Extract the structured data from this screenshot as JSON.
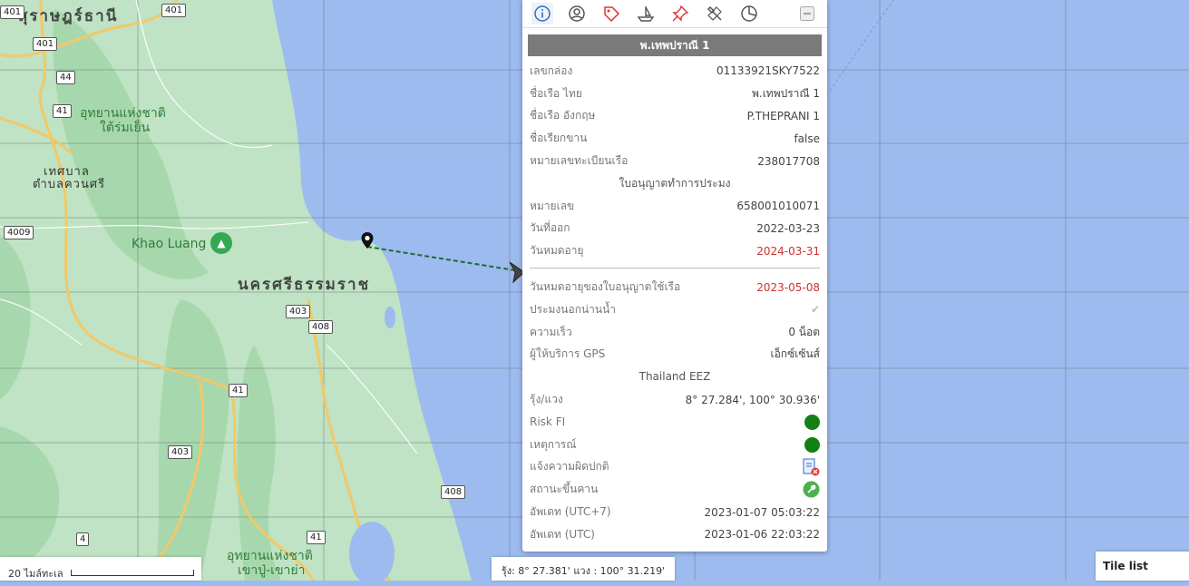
{
  "map": {
    "labels": {
      "surat_thani": "สุราษฎร์ธานี",
      "tessaban": "เทศบาล",
      "tessaban2": "ตำบลควนศรี",
      "park_north_1": "อุทยานแห่งชาติ",
      "park_north_2": "ใต้ร่มเย็น",
      "khao_luang": "Khao Luang",
      "nakhon": "นครศรีธรรมราช",
      "park_south_1": "อุทยานแห่งชาติ",
      "park_south_2": "เขาปู่-เขาย่า"
    },
    "roads": {
      "r401a": "401",
      "r401b": "401",
      "r44": "44",
      "r41a": "41",
      "r4009": "4009",
      "r403a": "403",
      "r408a": "408",
      "r41b": "41",
      "r403b": "403",
      "r408b": "408",
      "r4": "4",
      "r41c": "41"
    }
  },
  "popup": {
    "tabs": [
      {
        "name": "info"
      },
      {
        "name": "owner"
      },
      {
        "name": "tag"
      },
      {
        "name": "ship"
      },
      {
        "name": "pin"
      },
      {
        "name": "tools"
      },
      {
        "name": "chart"
      }
    ],
    "title": "พ.เทพปราณี 1",
    "rows_top": [
      {
        "label": "เลขกล่อง",
        "value": "01133921SKY7522"
      },
      {
        "label": "ชื่อเรือ ไทย",
        "value": "พ.เทพปราณี 1"
      },
      {
        "label": "ชื่อเรือ อังกฤษ",
        "value": "P.THEPRANI 1"
      },
      {
        "label": "ชื่อเรียกขาน",
        "value": "false"
      },
      {
        "label": "หมายเลขทะเบียนเรือ",
        "value": "238017708"
      }
    ],
    "license_section": "ใบอนุญาตทำการประมง",
    "rows_license": [
      {
        "label": "หมายเลข",
        "value": "658001010071"
      },
      {
        "label": "วันที่ออก",
        "value": "2022-03-23"
      },
      {
        "label": "วันหมดอายุ",
        "value": "2024-03-31"
      }
    ],
    "rows_bottom": [
      {
        "label": "วันหมดอายุของใบอนุญาตใช้เรือ",
        "value": "2023-05-08"
      },
      {
        "label": "ประมงนอกน่านน้ำ",
        "value": "✔"
      },
      {
        "label": "ความเร็ว",
        "value": "0 น็อต"
      },
      {
        "label": "ผู้ให้บริการ GPS",
        "value": "เอ็กซ์เซ้นส์"
      }
    ],
    "zone_section": "Thailand EEZ",
    "rows_status": [
      {
        "label": "รุ้ง/แวง",
        "value": "8° 27.284', 100° 30.936'"
      },
      {
        "label": "Risk FI",
        "value": ""
      },
      {
        "label": "เหตุการณ์",
        "value": ""
      },
      {
        "label": "แจ้งความผิดปกติ",
        "value": ""
      },
      {
        "label": "สถานะขึ้นคาน",
        "value": ""
      },
      {
        "label": "อัพเดท (UTC+7)",
        "value": "2023-01-07 05:03:22"
      },
      {
        "label": "อัพเดท (UTC)",
        "value": "2023-01-06 22:03:22"
      }
    ],
    "colors": {
      "title_bg": "#7a7a7a",
      "expired_red": "#d32f2f",
      "status_green": "#138013"
    }
  },
  "scale": {
    "label": "20 ไมล์ทะเล"
  },
  "coords": {
    "text": "รุ้ง: 8° 27.381' แวง : 100° 31.219'"
  },
  "tile_list": {
    "label": "Tile list"
  }
}
